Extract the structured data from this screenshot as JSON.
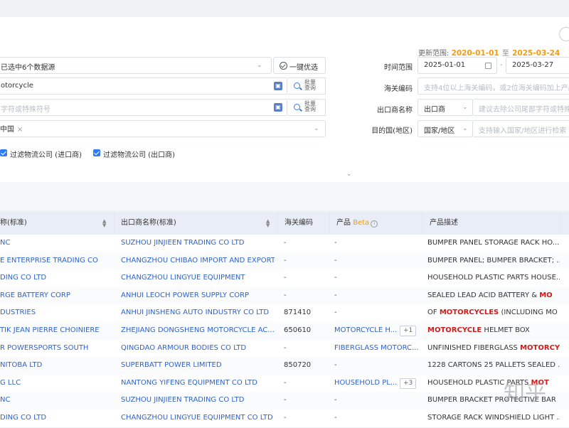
{
  "filters": {
    "update_range_label": "更新范围:",
    "update_range_start": "2020-01-01",
    "update_range_to": "至",
    "update_range_end": "2025-03-24",
    "datasource_value": "已选中6个数据源",
    "one_key_label": "一键优选",
    "product_value": "otorcycle",
    "hs_placeholder_left": "字符或特殊符号",
    "country_tag": "中国",
    "batch_query_label": "批量查询",
    "time_range_label": "时间范围",
    "date_start": "2025-01-01",
    "date_end": "2025-03-27",
    "hs_code_label": "海关编码",
    "hs_code_placeholder": "支持4位以上海关编码，或2位海关编码加上产品",
    "exporter_label": "出口商名称",
    "exporter_select": "出口商",
    "exporter_placeholder": "建议去除公司尾部字符或特殊",
    "destination_label": "目的国(地区)",
    "destination_select": "国家/地区",
    "destination_placeholder": "支持输入国家/地区进行检索",
    "filter_logistics_importer": "过滤物流公司 (进口商)",
    "filter_logistics_exporter": "过滤物流公司 (出口商)"
  },
  "table": {
    "headers": {
      "importer": "称(标准)",
      "exporter": "出口商名称(标准)",
      "hs": "海关编码",
      "product": "产品",
      "product_beta": "Beta",
      "desc": "产品描述"
    },
    "rows": [
      {
        "importer": "NC",
        "exporter": "SUZHOU JINJIEEN TRADING CO LTD",
        "hs": "-",
        "product": "-",
        "more": "",
        "desc_pre": "BUMPER PANEL STORAGE RACK HO...",
        "desc_hl": "",
        "desc_post": ""
      },
      {
        "importer": "E ENTERPRISE TRADING CO",
        "exporter": "CHANGZHOU CHIBAO IMPORT AND EXPORT",
        "hs": "-",
        "product": "-",
        "more": "",
        "desc_pre": "BUMPER PANEL; BUMPER BRACKET; ...",
        "desc_hl": "",
        "desc_post": ""
      },
      {
        "importer": "DING CO LTD",
        "exporter": "CHANGZHOU LINGYUE EQUIPMENT",
        "hs": "-",
        "product": "-",
        "more": "",
        "desc_pre": "HOUSEHOLD PLASTIC PARTS HOUSE...",
        "desc_hl": "",
        "desc_post": ""
      },
      {
        "importer": "RGE BATTERY CORP",
        "exporter": "ANHUI LEOCH POWER SUPPLY CORP",
        "hs": "-",
        "product": "-",
        "more": "",
        "desc_pre": "SEALED LEAD ACID BATTERY & ",
        "desc_hl": "MO",
        "desc_post": ""
      },
      {
        "importer": "DUSTRIES",
        "exporter": "ANHUI JINSHENG AUTO INDUSTRY CO LTD",
        "hs": "871410",
        "product": "-",
        "more": "",
        "desc_pre": "OF ",
        "desc_hl": "MOTORCYCLES",
        "desc_post": " (INCLUDING MO"
      },
      {
        "importer": "TIK JEAN PIERRE CHOINIERE",
        "exporter": "ZHEJIANG DONGSHENG MOTORCYCLE AC...",
        "hs": "650610",
        "product": "MOTORCYCLE H...",
        "more": "+1",
        "desc_pre": "",
        "desc_hl": "MOTORCYCLE",
        "desc_post": " HELMET BOX"
      },
      {
        "importer": "R POWERSPORTS SOUTH",
        "exporter": "QINGDAO ARMOUR BODIES CO LTD",
        "hs": "-",
        "product": "FIBERGLASS MOTORC...",
        "more": "",
        "desc_pre": "UNFINISHED FIBERGLASS ",
        "desc_hl": "MOTORCY",
        "desc_post": ""
      },
      {
        "importer": "NITOBA LTD",
        "exporter": "SUPERBATT POWER LIMITED",
        "hs": "850720",
        "product": "-",
        "more": "",
        "desc_pre": "1228 CARTONS 25 PALLETS SEALED ...",
        "desc_hl": "",
        "desc_post": ""
      },
      {
        "importer": "G LLC",
        "exporter": "NANTONG YIFENG EQUIPMENT CO LTD",
        "hs": "-",
        "product": "HOUSEHOLD PL...",
        "more": "+3",
        "desc_pre": "HOUSEHOLD PLASTIC PARTS ",
        "desc_hl": "MOT",
        "desc_post": ""
      },
      {
        "importer": "NC",
        "exporter": "SUZHOU JINJIEEN TRADING CO LTD",
        "hs": "-",
        "product": "-",
        "more": "",
        "desc_pre": "BUMPER BRACKET PROTECTIVE BAR",
        "desc_hl": "",
        "desc_post": ""
      },
      {
        "importer": "DING CO LTD",
        "exporter": "CHANGZHOU LINGYUE EQUIPMENT CO LTD",
        "hs": "-",
        "product": "-",
        "more": "",
        "desc_pre": "STORAGE RACK WINDSHIELD LIGHT ...",
        "desc_hl": "",
        "desc_post": ""
      }
    ]
  },
  "watermark": "知乎",
  "icons": [
    "chevron-down-icon",
    "check-circle-icon",
    "calendar-icon",
    "search-icon",
    "image-search-icon",
    "sort-icon",
    "info-icon",
    "checkbox-icon",
    "close-icon",
    "expand-chevron-icon"
  ],
  "colors": {
    "accent": "#2f63c9",
    "highlight": "#d11a1a",
    "date_orange": "#f39c12",
    "checkbox": "#2f7cf6",
    "header_bg": "#e8edf7"
  }
}
